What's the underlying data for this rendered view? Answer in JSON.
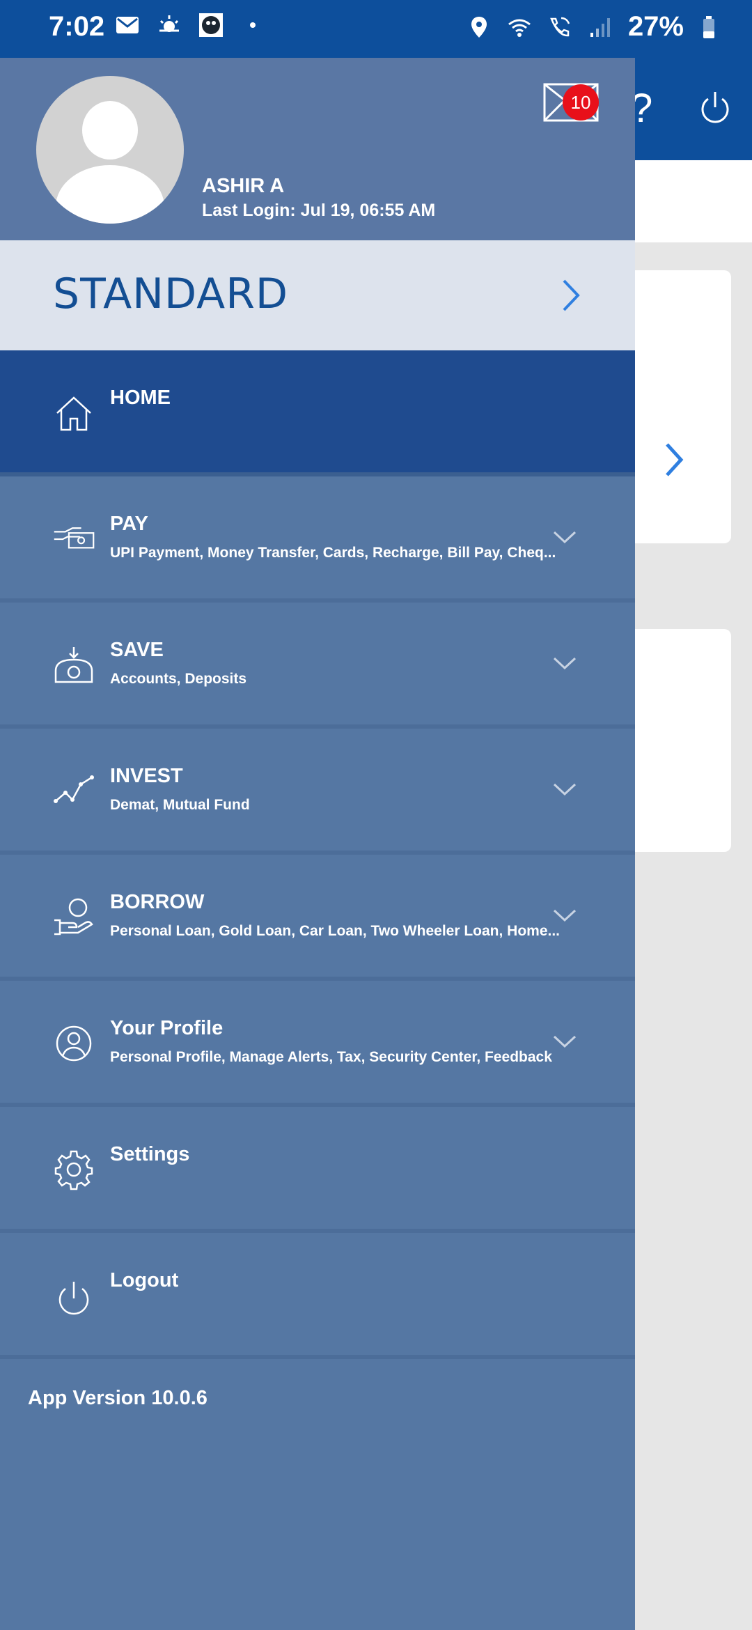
{
  "status_bar": {
    "time": "7:02",
    "battery": "27%",
    "left_icons": [
      "gmail-icon",
      "weather-icon",
      "app-icon",
      "dot-icon"
    ],
    "right_icons": [
      "location-icon",
      "wifi-icon",
      "wifi-call-icon",
      "signal-icon",
      "battery-icon"
    ]
  },
  "profile": {
    "name": "ASHIR A",
    "last_login": "Last Login: Jul 19, 06:55 AM",
    "mail_badge": "10"
  },
  "plan": {
    "label": "STANDARD"
  },
  "menu": [
    {
      "title": "HOME",
      "subtitle": "",
      "icon": "home-icon",
      "active": true
    },
    {
      "title": "PAY",
      "subtitle": "UPI Payment, Money Transfer, Cards, Recharge, Bill Pay, Cheq...",
      "icon": "pay-icon"
    },
    {
      "title": "SAVE",
      "subtitle": "Accounts, Deposits",
      "icon": "save-icon"
    },
    {
      "title": "INVEST",
      "subtitle": "Demat, Mutual Fund",
      "icon": "invest-icon"
    },
    {
      "title": "BORROW",
      "subtitle": "Personal Loan, Gold Loan, Car Loan, Two Wheeler Loan, Home...",
      "icon": "borrow-icon"
    },
    {
      "title": "Your Profile",
      "subtitle": "Personal Profile, Manage Alerts, Tax, Security Center, Feedback",
      "icon": "profile-icon"
    },
    {
      "title": "Settings",
      "subtitle": "",
      "icon": "settings-icon"
    },
    {
      "title": "Logout",
      "subtitle": "",
      "icon": "logout-icon"
    }
  ],
  "app_version": "App Version 10.0.6",
  "colors": {
    "status_bar": "#0d4f9c",
    "drawer": "#5577a3",
    "active_item": "#1f4b8f",
    "plan_bg": "#dde3ed",
    "plan_text": "#134e93",
    "badge": "#e8101a"
  }
}
